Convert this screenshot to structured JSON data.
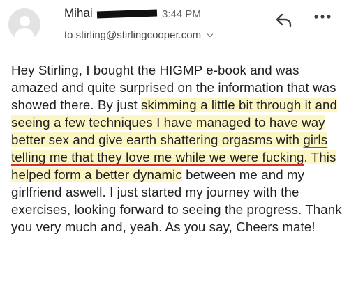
{
  "email": {
    "sender_first_name": "Mihai",
    "time": "3:44 PM",
    "to_line": "to stirling@stirlingcooper.com",
    "body": {
      "plain_1": "Hey Stirling, I bought the HIGMP e-book and was amazed and quite surprised on the information that was showed there. By just",
      "highlight_1": "skimming a little bit through it and seeing a few techniques I have managed to have way better sex and give earth shattering orgasms with",
      "underlined_1": "girls telling me that they love me while we were fucking",
      "highlight_2": ". This helped form a better dynamic",
      "plain_2": "between me and my girlfriend aswell. I just started my journey with the exercises, looking forward to seeing the progress. Thank you very much and, yeah. As you say, Cheers mate!"
    }
  },
  "icons": {
    "avatar": "default-avatar-icon",
    "reply": "reply-icon",
    "more": "more-options-icon",
    "expand": "chevron-down-icon"
  },
  "colors": {
    "highlight": "#fcf6c4",
    "underline": "#d93025",
    "avatar_bg": "#e2e3e5"
  }
}
